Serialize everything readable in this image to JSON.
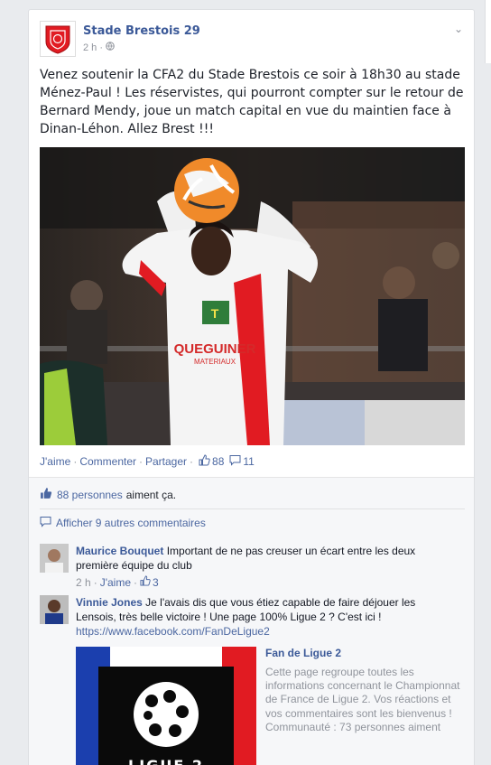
{
  "post": {
    "page_name": "Stade Brestois 29",
    "time": "2 h",
    "audience_icon": "globe-icon",
    "text": "Venez soutenir la CFA2 du Stade Brestois ce soir à 18h30 au stade Ménez-Paul ! Les réservistes, qui pourront compter sur le retour de Bernard Mendy, joue un match capital en vue du maintien face à Dinan-Léhon. Allez Brest !!!",
    "photo": {
      "sponsor_text": "QUEGUINER",
      "sponsor_sub": "MATERIAUX"
    },
    "actions": {
      "like": "J'aime",
      "comment": "Commenter",
      "share": "Partager",
      "likes_count": "88",
      "comments_count": "11"
    }
  },
  "feedback": {
    "likes_count": "88 personnes",
    "likes_suffix": "aiment ça.",
    "view_more": "Afficher 9 autres commentaires"
  },
  "comments": [
    {
      "author": "Maurice Bouquet",
      "text": "Important de ne pas creuser un écart entre les deux première équipe du club",
      "time": "2 h",
      "like_label": "J'aime",
      "likes": "3"
    },
    {
      "author": "Vinnie Jones",
      "text": "Je l'avais dis que vous étiez capable de faire déjouer les Lensois, très belle victoire ! Une page 100% Ligue 2 ? C'est ici !",
      "url": "https://www.facebook.com/FanDeLigue2"
    }
  ],
  "shared_page": {
    "title": "Fan de Ligue 2",
    "description": "Cette page regroupe toutes les informations concernant le Championnat de France de Ligue 2. Vos réactions et vos commentaires sont les bienvenus !",
    "community": "Communauté : 73 personnes aiment",
    "logo_text": "LIGUE 2"
  },
  "colors": {
    "link": "#4b67a1",
    "name": "#3b5998",
    "brest_red": "#e11b22"
  }
}
